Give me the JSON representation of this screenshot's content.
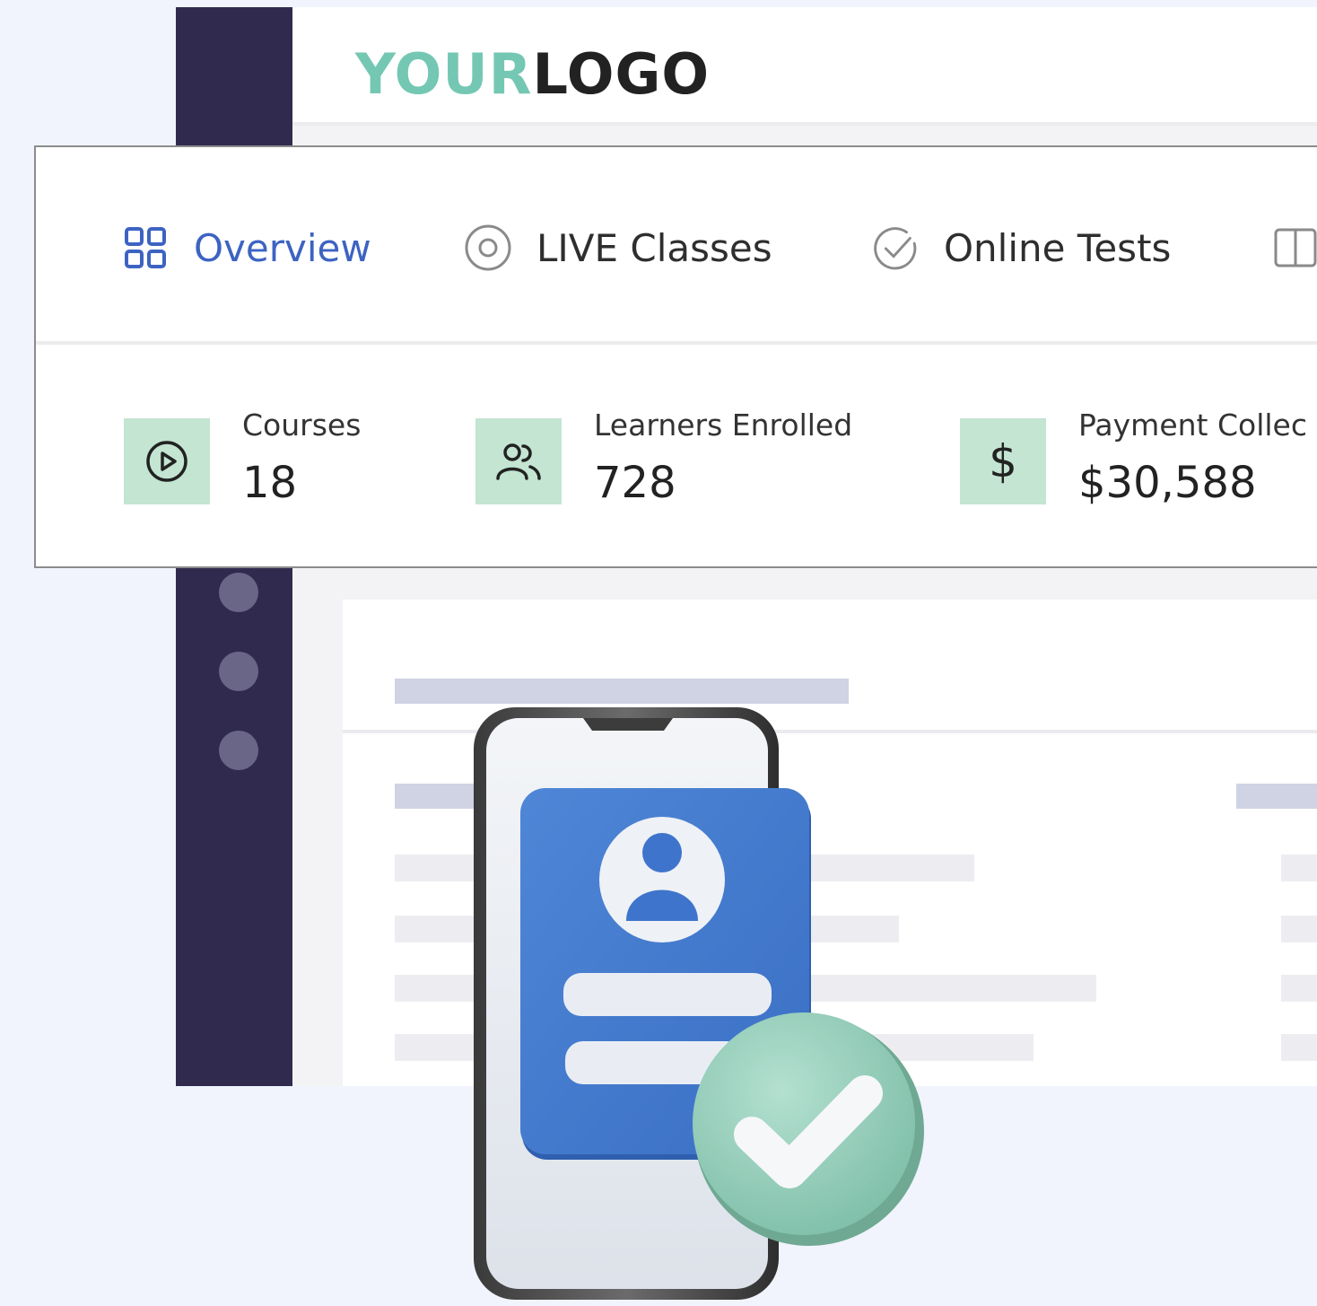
{
  "brand": {
    "logo_part1": "YOUR",
    "logo_part2": "LOGO"
  },
  "tabs": [
    {
      "label": "Overview",
      "icon": "grid-icon",
      "active": true
    },
    {
      "label": "LIVE Classes",
      "icon": "live-circle-icon",
      "active": false
    },
    {
      "label": "Online Tests",
      "icon": "check-circle-icon",
      "active": false
    },
    {
      "label": "",
      "icon": "book-icon",
      "active": false
    }
  ],
  "stats": [
    {
      "label": "Courses",
      "value": "18",
      "icon": "play-icon"
    },
    {
      "label": "Learners Enrolled",
      "value": "728",
      "icon": "users-icon"
    },
    {
      "label": "Payment Collec",
      "value": "$30,588",
      "icon": "dollar-icon"
    }
  ],
  "colors": {
    "accent": "#3d63c2",
    "sidebar": "#302b4e",
    "stat_icon_bg": "#c3e5d2",
    "logo_teal": "#74c7b3",
    "card_blue": "#4a7ed0",
    "check_green": "#9bd1bf"
  },
  "illustration": {
    "type": "phone-profile-verified"
  }
}
